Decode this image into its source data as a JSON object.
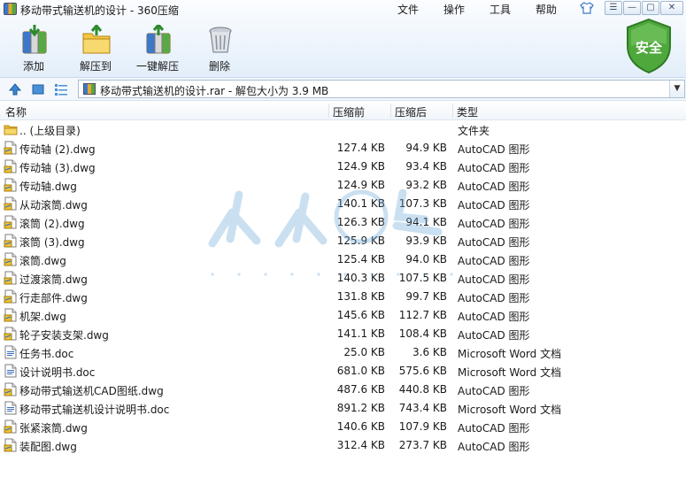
{
  "window": {
    "title": "移动带式输送机的设计 - 360压缩"
  },
  "menu": {
    "file": "文件",
    "operate": "操作",
    "tools": "工具",
    "help": "帮助"
  },
  "toolbar": {
    "add": "添加",
    "extract_to": "解压到",
    "one_click_extract": "一键解压",
    "delete": "删除",
    "security_badge": "安全"
  },
  "address": {
    "text": "移动带式输送机的设计.rar - 解包大小为 3.9 MB"
  },
  "columns": {
    "name": "名称",
    "size": "压缩前",
    "packed": "压缩后",
    "type": "类型"
  },
  "files": [
    {
      "name": ".. (上级目录)",
      "size": "",
      "packed": "",
      "type": "文件夹",
      "icon": "folder-icon"
    },
    {
      "name": "传动轴 (2).dwg",
      "size": "127.4 KB",
      "packed": "94.9 KB",
      "type": "AutoCAD 图形",
      "icon": "dwg-file-icon"
    },
    {
      "name": "传动轴 (3).dwg",
      "size": "124.9 KB",
      "packed": "93.4 KB",
      "type": "AutoCAD 图形",
      "icon": "dwg-file-icon"
    },
    {
      "name": "传动轴.dwg",
      "size": "124.9 KB",
      "packed": "93.2 KB",
      "type": "AutoCAD 图形",
      "icon": "dwg-file-icon"
    },
    {
      "name": "从动滚筒.dwg",
      "size": "140.1 KB",
      "packed": "107.3 KB",
      "type": "AutoCAD 图形",
      "icon": "dwg-file-icon"
    },
    {
      "name": "滚筒 (2).dwg",
      "size": "126.3 KB",
      "packed": "94.1 KB",
      "type": "AutoCAD 图形",
      "icon": "dwg-file-icon"
    },
    {
      "name": "滚筒 (3).dwg",
      "size": "125.9 KB",
      "packed": "93.9 KB",
      "type": "AutoCAD 图形",
      "icon": "dwg-file-icon"
    },
    {
      "name": "滚筒.dwg",
      "size": "125.4 KB",
      "packed": "94.0 KB",
      "type": "AutoCAD 图形",
      "icon": "dwg-file-icon"
    },
    {
      "name": "过渡滚筒.dwg",
      "size": "140.3 KB",
      "packed": "107.5 KB",
      "type": "AutoCAD 图形",
      "icon": "dwg-file-icon"
    },
    {
      "name": "行走部件.dwg",
      "size": "131.8 KB",
      "packed": "99.7 KB",
      "type": "AutoCAD 图形",
      "icon": "dwg-file-icon"
    },
    {
      "name": "机架.dwg",
      "size": "145.6 KB",
      "packed": "112.7 KB",
      "type": "AutoCAD 图形",
      "icon": "dwg-file-icon"
    },
    {
      "name": "轮子安装支架.dwg",
      "size": "141.1 KB",
      "packed": "108.4 KB",
      "type": "AutoCAD 图形",
      "icon": "dwg-file-icon"
    },
    {
      "name": "任务书.doc",
      "size": "25.0 KB",
      "packed": "3.6 KB",
      "type": "Microsoft Word 文档",
      "icon": "doc-file-icon"
    },
    {
      "name": "设计说明书.doc",
      "size": "681.0 KB",
      "packed": "575.6 KB",
      "type": "Microsoft Word 文档",
      "icon": "doc-file-icon"
    },
    {
      "name": "移动带式输送机CAD图纸.dwg",
      "size": "487.6 KB",
      "packed": "440.8 KB",
      "type": "AutoCAD 图形",
      "icon": "dwg-file-icon"
    },
    {
      "name": "移动带式输送机设计说明书.doc",
      "size": "891.2 KB",
      "packed": "743.4 KB",
      "type": "Microsoft Word 文档",
      "icon": "doc-file-icon"
    },
    {
      "name": "张紧滚筒.dwg",
      "size": "140.6 KB",
      "packed": "107.9 KB",
      "type": "AutoCAD 图形",
      "icon": "dwg-file-icon"
    },
    {
      "name": "装配图.dwg",
      "size": "312.4 KB",
      "packed": "273.7 KB",
      "type": "AutoCAD 图形",
      "icon": "dwg-file-icon"
    }
  ],
  "colors": {
    "accent": "#3a86c8",
    "shield": "#4ea83c",
    "folder": "#f0c23c"
  }
}
